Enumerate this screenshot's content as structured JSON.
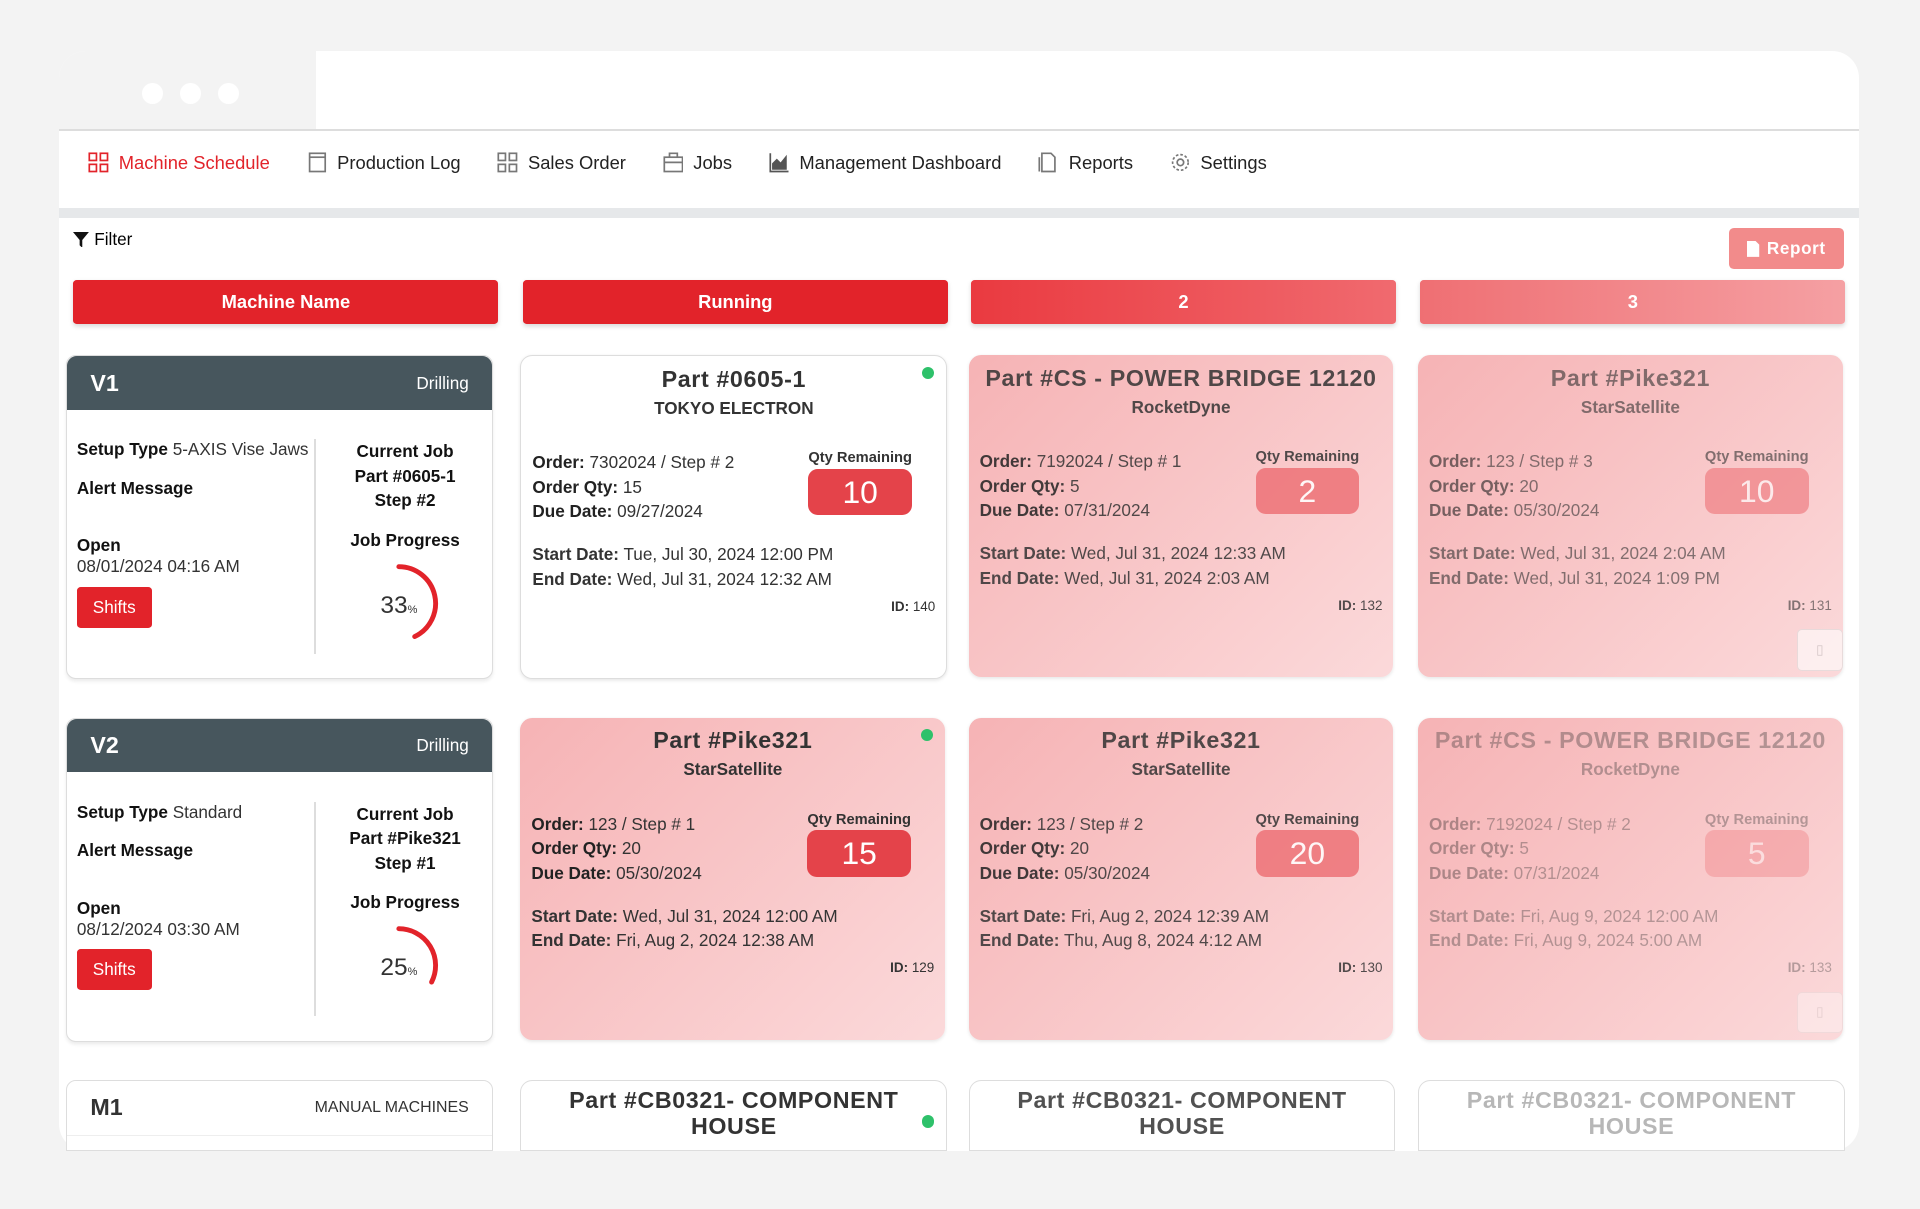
{
  "colors": {
    "accent": "#e2232a",
    "header_dark": "#47565d",
    "running_dot": "#2ec16a"
  },
  "nav": [
    {
      "label": "Machine Schedule",
      "icon": "grid-icon",
      "active": true
    },
    {
      "label": "Production Log",
      "icon": "calendar-icon"
    },
    {
      "label": "Sales Order",
      "icon": "grid-icon"
    },
    {
      "label": "Jobs",
      "icon": "briefcase-icon"
    },
    {
      "label": "Management Dashboard",
      "icon": "chart-icon"
    },
    {
      "label": "Reports",
      "icon": "document-icon"
    },
    {
      "label": "Settings",
      "icon": "gear-icon"
    }
  ],
  "toolbar": {
    "filter_label": "Filter",
    "report_label": "Report"
  },
  "columns": [
    "Machine Name",
    "Running",
    "2",
    "3"
  ],
  "labels": {
    "setup_type": "Setup Type",
    "alert": "Alert Message",
    "current_job": "Current Job",
    "job_progress": "Job Progress",
    "shifts": "Shifts",
    "order": "Order:",
    "order_qty": "Order Qty:",
    "due": "Due Date:",
    "start": "Start Date:",
    "end": "End Date:",
    "qty_remaining": "Qty Remaining",
    "id": "ID:",
    "pct": "%"
  },
  "machines": [
    {
      "name": "V1",
      "type": "Drilling",
      "setup": "5-AXIS Vise Jaws",
      "status": "Open",
      "status_date": "08/01/2024 04:16 AM",
      "job_part": "Part #0605-1",
      "job_step": "Step #2",
      "progress": 33,
      "jobs": [
        {
          "part": "Part #0605-1",
          "customer": "TOKYO ELECTRON",
          "order": "7302024 / Step # 2",
          "order_qty": "15",
          "due": "09/27/2024",
          "qty_remaining": "10",
          "start": "Tue, Jul 30, 2024 12:00 PM",
          "end": "Wed, Jul 31, 2024 12:32 AM",
          "id": "140",
          "running": true
        },
        {
          "part": "Part #CS - POWER BRIDGE 12120",
          "customer": "RocketDyne",
          "order": "7192024 / Step # 1",
          "order_qty": "5",
          "due": "07/31/2024",
          "qty_remaining": "2",
          "start": "Wed, Jul 31, 2024 12:33 AM",
          "end": "Wed, Jul 31, 2024 2:03 AM",
          "id": "132"
        },
        {
          "part": "Part #Pike321",
          "customer": "StarSatellite",
          "order": "123 / Step # 3",
          "order_qty": "20",
          "due": "05/30/2024",
          "qty_remaining": "10",
          "start": "Wed, Jul 31, 2024 2:04 AM",
          "end": "Wed, Jul 31, 2024 1:09 PM",
          "id": "131"
        }
      ]
    },
    {
      "name": "V2",
      "type": "Drilling",
      "setup": "Standard",
      "status": "Open",
      "status_date": "08/12/2024 03:30 AM",
      "job_part": "Part #Pike321",
      "job_step": "Step #1",
      "progress": 25,
      "jobs": [
        {
          "part": "Part #Pike321",
          "customer": "StarSatellite",
          "order": "123 / Step # 1",
          "order_qty": "20",
          "due": "05/30/2024",
          "qty_remaining": "15",
          "start": "Wed, Jul 31, 2024 12:00 AM",
          "end": "Fri, Aug 2, 2024 12:38 AM",
          "id": "129",
          "running": true
        },
        {
          "part": "Part #Pike321",
          "customer": "StarSatellite",
          "order": "123 / Step # 2",
          "order_qty": "20",
          "due": "05/30/2024",
          "qty_remaining": "20",
          "start": "Fri, Aug 2, 2024 12:39 AM",
          "end": "Thu, Aug 8, 2024 4:12 AM",
          "id": "130"
        },
        {
          "part": "Part #CS - POWER BRIDGE 12120",
          "customer": "RocketDyne",
          "order": "7192024 / Step # 2",
          "order_qty": "5",
          "due": "07/31/2024",
          "qty_remaining": "5",
          "start": "Fri, Aug 9, 2024 12:00 AM",
          "end": "Fri, Aug 9, 2024 5:00 AM",
          "id": "133"
        }
      ]
    },
    {
      "name": "M1",
      "type": "MANUAL MACHINES",
      "jobs": [
        {
          "part": "Part #CB0321- COMPONENT HOUSE",
          "running": true
        },
        {
          "part": "Part #CB0321- COMPONENT HOUSE"
        },
        {
          "part": "Part #CB0321- COMPONENT HOUSE"
        }
      ]
    }
  ]
}
